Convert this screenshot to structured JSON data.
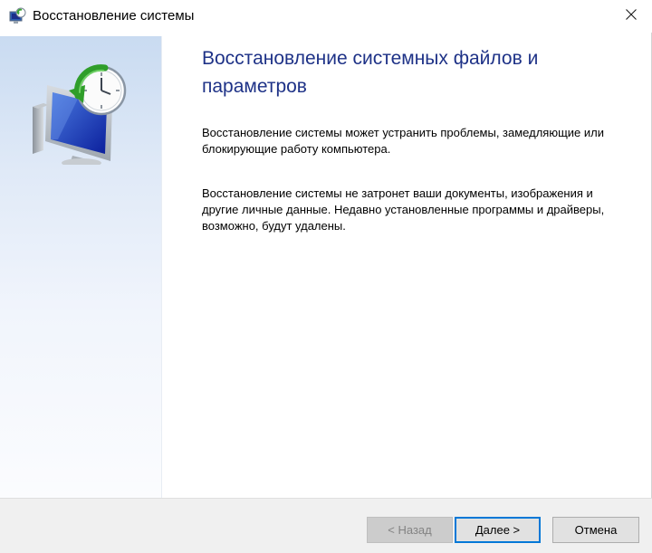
{
  "window": {
    "title": "Восстановление системы",
    "icon": "system-restore-icon",
    "close_icon": "close-icon"
  },
  "banner": {
    "art": "system-restore-monitor-clock-icon",
    "accent": "#c9dbf1"
  },
  "content": {
    "heading": "Восстановление системных файлов и параметров",
    "paragraph1": "Восстановление системы может устранить проблемы, замедляющие или блокирующие работу компьютера.",
    "paragraph2": "Восстановление системы не затронет ваши документы, изображения и другие личные данные. Недавно установленные программы и драйверы, возможно, будут удалены.",
    "heading_color": "#1e3287"
  },
  "footer": {
    "back_label": "< Назад",
    "back_enabled": false,
    "next_label": "Далее >",
    "cancel_label": "Отмена",
    "default_button_color": "#0078d7"
  }
}
